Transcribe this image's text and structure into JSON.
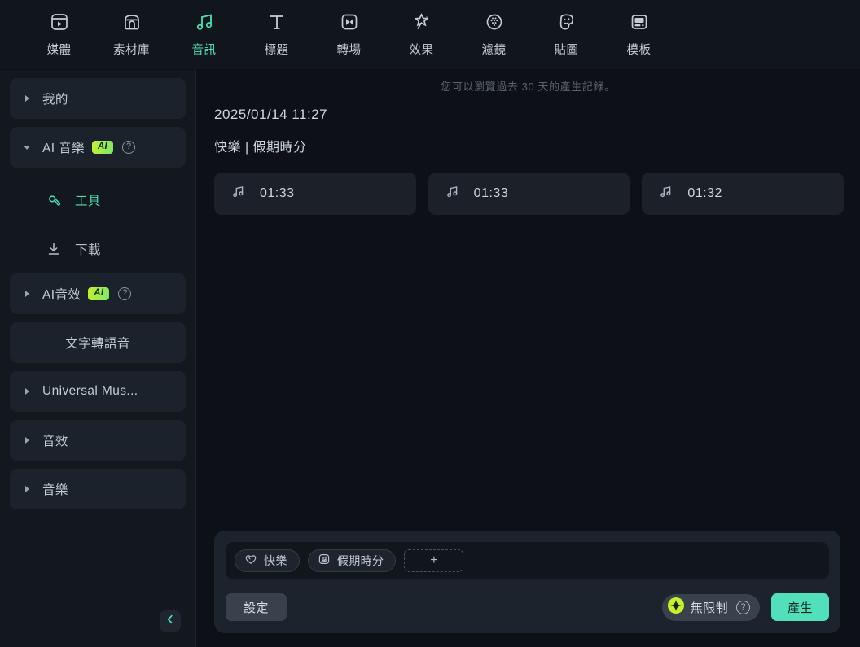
{
  "toolbar": {
    "items": [
      {
        "label": "媒體",
        "icon": "media-icon",
        "active": false
      },
      {
        "label": "素材庫",
        "icon": "store-icon",
        "active": false
      },
      {
        "label": "音訊",
        "icon": "music-note-icon",
        "active": true
      },
      {
        "label": "標題",
        "icon": "text-title-icon",
        "active": false
      },
      {
        "label": "轉場",
        "icon": "transition-icon",
        "active": false
      },
      {
        "label": "效果",
        "icon": "effect-wand-icon",
        "active": false
      },
      {
        "label": "濾鏡",
        "icon": "filter-icon",
        "active": false
      },
      {
        "label": "貼圖",
        "icon": "sticker-icon",
        "active": false
      },
      {
        "label": "模板",
        "icon": "template-icon",
        "active": false
      }
    ]
  },
  "sidebar": {
    "items": [
      {
        "label": "我的",
        "type": "group",
        "caret": "right",
        "badge": null,
        "help": false
      },
      {
        "label": "AI 音樂",
        "type": "group",
        "caret": "down",
        "badge": "AI",
        "help": true
      },
      {
        "label": "工具",
        "type": "sub",
        "icon": "wrench-icon",
        "active": true
      },
      {
        "label": "下載",
        "type": "sub",
        "icon": "download-icon",
        "active": false
      },
      {
        "label": "AI音效",
        "type": "group",
        "caret": "right",
        "badge": "AI",
        "help": true
      },
      {
        "label": "文字轉語音",
        "type": "plain",
        "caret": "none",
        "badge": null,
        "help": false
      },
      {
        "label": "Universal Mus...",
        "type": "group",
        "caret": "right",
        "badge": null,
        "help": false
      },
      {
        "label": "音效",
        "type": "group",
        "caret": "right",
        "badge": null,
        "help": false
      },
      {
        "label": "音樂",
        "type": "group",
        "caret": "right",
        "badge": null,
        "help": false
      }
    ],
    "collapse_icon": "chevron-left-icon"
  },
  "main": {
    "hint": "您可以瀏覽過去 30 天的產生記錄。",
    "result": {
      "date": "2025/01/14 11:27",
      "title": "快樂 | 假期時分",
      "cards": [
        {
          "icon": "music-note-icon",
          "duration": "01:33"
        },
        {
          "icon": "music-note-icon",
          "duration": "01:33"
        },
        {
          "icon": "music-note-icon",
          "duration": "01:32"
        }
      ]
    }
  },
  "prompt_panel": {
    "tags": [
      {
        "label": "快樂",
        "icon": "mood-heart-icon"
      },
      {
        "label": "假期時分",
        "icon": "music-box-icon"
      }
    ],
    "add_label": "+",
    "settings_label": "設定",
    "credits_label": "無限制",
    "credits_icon": "diamond-spark-icon",
    "credits_help": "?",
    "generate_label": "產生"
  },
  "colors": {
    "accent_teal": "#52e0bb",
    "badge_green": "#c5f22b",
    "panel_bg": "#1c232c",
    "app_bg": "#0d1117"
  }
}
